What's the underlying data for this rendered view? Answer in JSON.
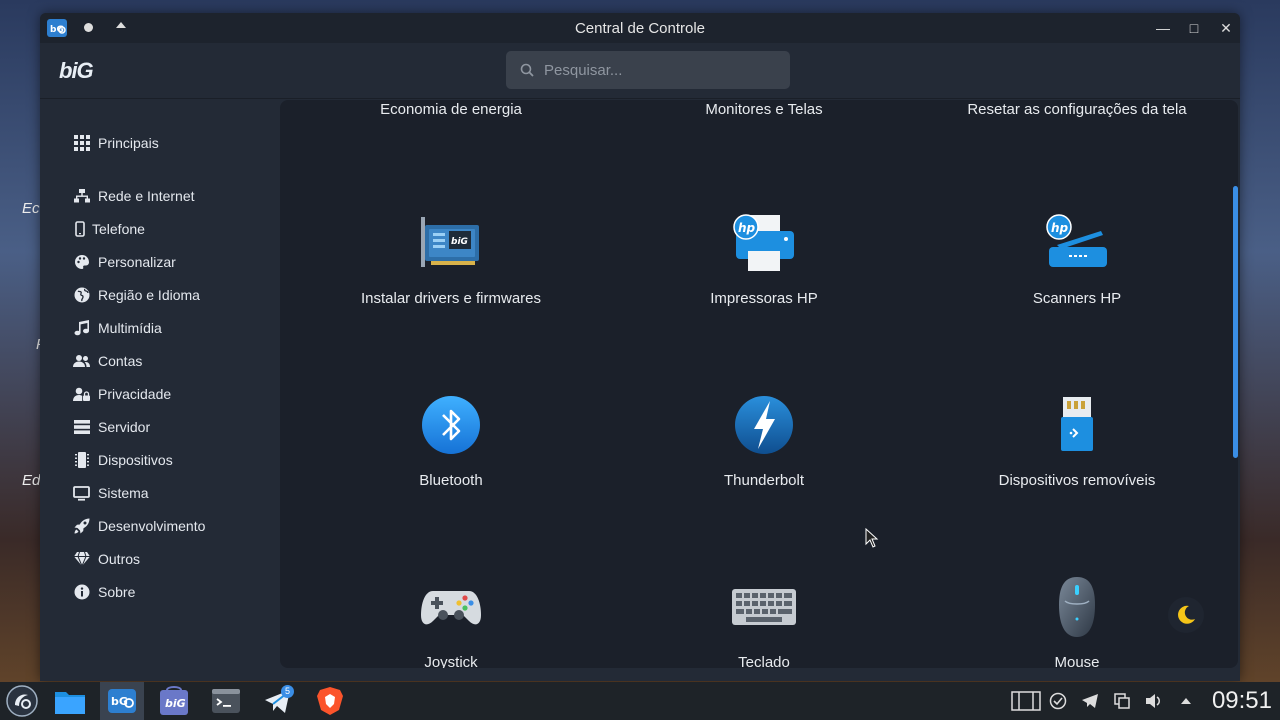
{
  "window": {
    "title": "Central de Controle"
  },
  "header": {
    "logo_text": "biG",
    "search_placeholder": "Pesquisar..."
  },
  "sidebar": {
    "items": [
      {
        "label": "Principais",
        "icon": "grid-icon"
      },
      {
        "label": "Rede e Internet",
        "icon": "network-icon"
      },
      {
        "label": "Telefone",
        "icon": "phone-icon"
      },
      {
        "label": "Personalizar",
        "icon": "palette-icon"
      },
      {
        "label": "Região e Idioma",
        "icon": "globe-icon"
      },
      {
        "label": "Multimídia",
        "icon": "music-icon"
      },
      {
        "label": "Contas",
        "icon": "users-icon"
      },
      {
        "label": "Privacidade",
        "icon": "user-lock-icon"
      },
      {
        "label": "Servidor",
        "icon": "server-icon"
      },
      {
        "label": "Dispositivos",
        "icon": "chip-icon"
      },
      {
        "label": "Sistema",
        "icon": "monitor-icon"
      },
      {
        "label": "Desenvolvimento",
        "icon": "rocket-icon"
      },
      {
        "label": "Outros",
        "icon": "gem-icon"
      },
      {
        "label": "Sobre",
        "icon": "info-icon"
      }
    ]
  },
  "tiles": [
    {
      "label": "Economia de energia"
    },
    {
      "label": "Monitores e Telas"
    },
    {
      "label": "Resetar as configurações da tela"
    },
    {
      "label": "Instalar drivers e firmwares",
      "icon": "driver-card-icon"
    },
    {
      "label": "Impressoras HP",
      "icon": "hp-printer-icon"
    },
    {
      "label": "Scanners HP",
      "icon": "hp-scanner-icon"
    },
    {
      "label": "Bluetooth",
      "icon": "bluetooth-icon"
    },
    {
      "label": "Thunderbolt",
      "icon": "thunderbolt-icon"
    },
    {
      "label": "Dispositivos removíveis",
      "icon": "usb-drive-icon"
    },
    {
      "label": "Joystick",
      "icon": "gamepad-icon"
    },
    {
      "label": "Teclado",
      "icon": "keyboard-icon"
    },
    {
      "label": "Mouse",
      "icon": "mouse-icon"
    }
  ],
  "desktop": {
    "fragments": [
      "Ec",
      "P",
      "Edi"
    ]
  },
  "taskbar": {
    "apps": [
      {
        "name": "big-linux-launcher"
      },
      {
        "name": "file-manager"
      },
      {
        "name": "control-center"
      },
      {
        "name": "big-store"
      },
      {
        "name": "terminal"
      },
      {
        "name": "telegram",
        "badge": "5"
      },
      {
        "name": "brave-browser"
      }
    ],
    "clock": "09:51"
  },
  "colors": {
    "accent": "#3a8ee6",
    "window_bg": "#232a36",
    "content_bg": "#1b202a",
    "moon": "#f5c518"
  }
}
